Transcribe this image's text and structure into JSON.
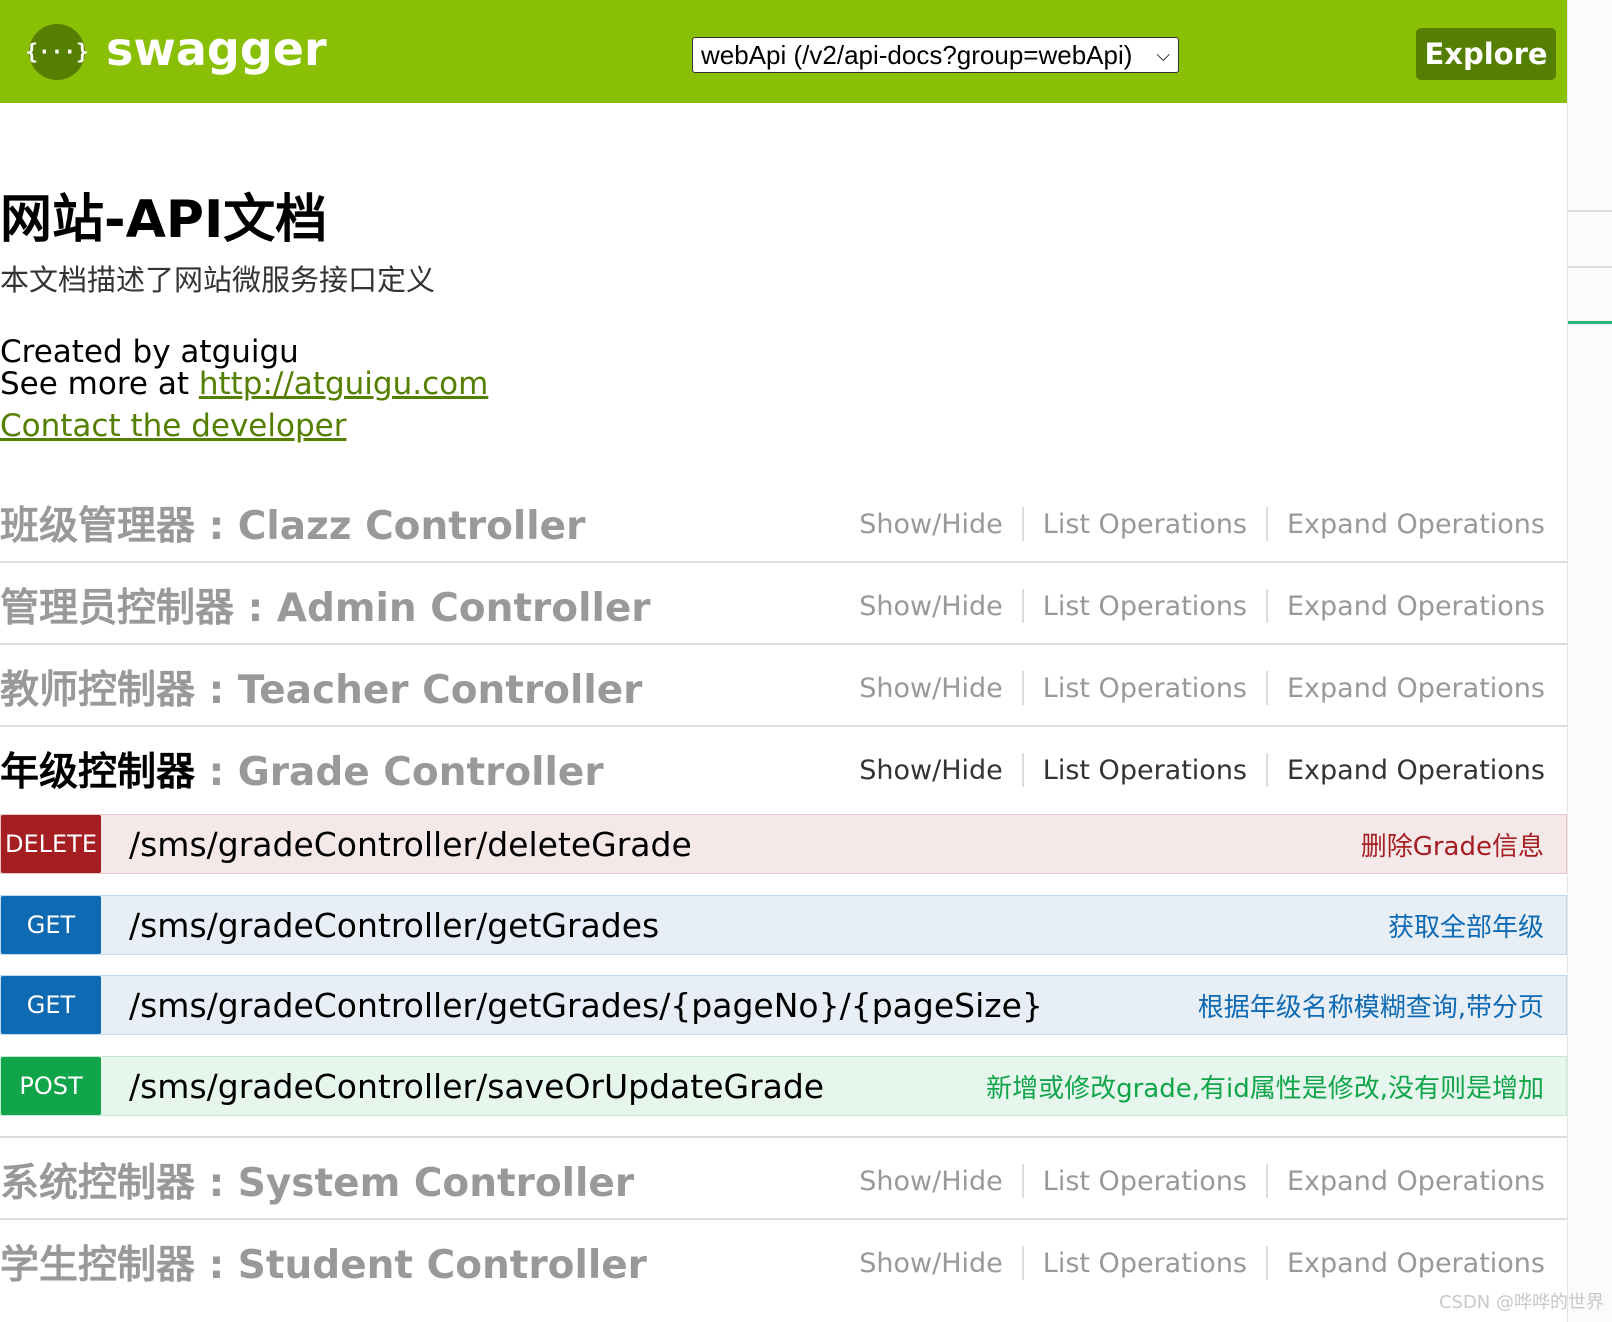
{
  "header": {
    "logo_glyph": "{···}",
    "logo_text": "swagger",
    "api_select_value": "webApi (/v2/api-docs?group=webApi)",
    "explore_label": "Explore",
    "bg_color": "#89bf04"
  },
  "info": {
    "title": "网站-API文档",
    "description": "本文档描述了网站微服务接口定义",
    "created_by": "Created by atguigu",
    "see_more_prefix": "See more at ",
    "see_more_link": "http://atguigu.com",
    "contact_link": "Contact the developer"
  },
  "resource_ops": {
    "show_hide": "Show/Hide",
    "list_operations": "List Operations",
    "expand_operations": "Expand Operations"
  },
  "resources": [
    {
      "zh": "班级管理器",
      "sep": " : ",
      "en": "Clazz Controller",
      "expanded": false
    },
    {
      "zh": "管理员控制器",
      "sep": " : ",
      "en": "Admin Controller",
      "expanded": false
    },
    {
      "zh": "教师控制器",
      "sep": " : ",
      "en": "Teacher Controller",
      "expanded": false
    },
    {
      "zh": "年级控制器",
      "sep": " : ",
      "en": "Grade Controller",
      "expanded": true
    },
    {
      "zh": "系统控制器",
      "sep": " : ",
      "en": "System Controller",
      "expanded": false
    },
    {
      "zh": "学生控制器",
      "sep": " : ",
      "en": "Student Controller",
      "expanded": false
    }
  ],
  "operations": [
    {
      "method": "DELETE",
      "path": "/sms/gradeController/deleteGrade",
      "summary": "删除Grade信息",
      "color": "#a41e22"
    },
    {
      "method": "GET",
      "path": "/sms/gradeController/getGrades",
      "summary": "获取全部年级",
      "color": "#0f6ab4"
    },
    {
      "method": "GET",
      "path": "/sms/gradeController/getGrades/{pageNo}/{pageSize}",
      "summary": "根据年级名称模糊查询,带分页",
      "color": "#0f6ab4"
    },
    {
      "method": "POST",
      "path": "/sms/gradeController/saveOrUpdateGrade",
      "summary": "新增或修改grade,有id属性是修改,没有则是增加",
      "color": "#10a54a"
    }
  ],
  "watermark": "CSDN @哗哗的世界"
}
